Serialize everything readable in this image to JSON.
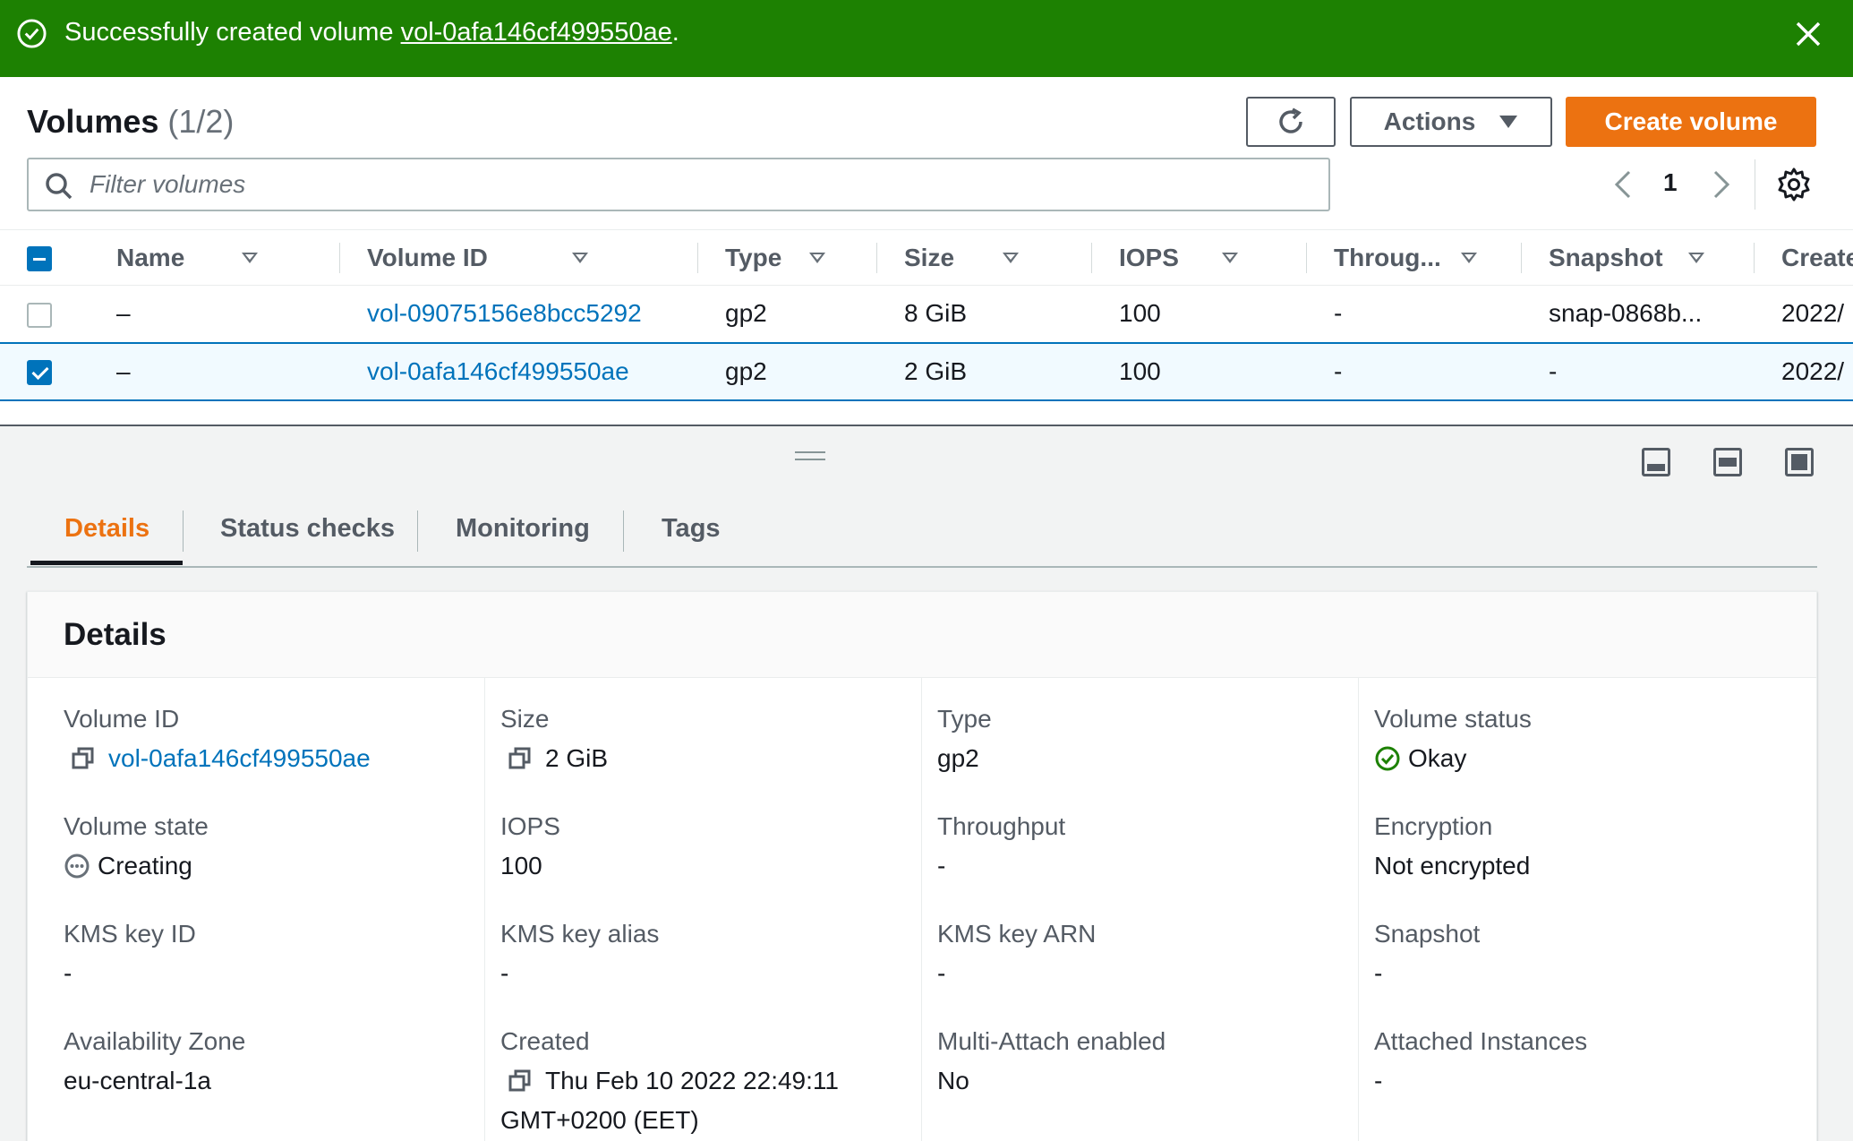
{
  "flash": {
    "message_prefix": "Successfully created volume ",
    "volume_link": "vol-0afa146cf499550ae",
    "message_suffix": ".",
    "color": "#1d8102"
  },
  "header": {
    "title": "Volumes",
    "count": "(1/2)",
    "actions_label": "Actions",
    "create_label": "Create volume",
    "accent_color": "#ec7211"
  },
  "filter": {
    "placeholder": "Filter volumes",
    "value": ""
  },
  "pager": {
    "page": "1"
  },
  "table": {
    "columns": [
      "Name",
      "Volume ID",
      "Type",
      "Size",
      "IOPS",
      "Throug...",
      "Snapshot",
      "Create"
    ],
    "rows": [
      {
        "selected": false,
        "name": "–",
        "volume_id": "vol-09075156e8bcc5292",
        "type": "gp2",
        "size": "8 GiB",
        "iops": "100",
        "throughput": "-",
        "snapshot": "snap-0868b...",
        "created": "2022/"
      },
      {
        "selected": true,
        "name": "–",
        "volume_id": "vol-0afa146cf499550ae",
        "type": "gp2",
        "size": "2 GiB",
        "iops": "100",
        "throughput": "-",
        "snapshot": "-",
        "created": "2022/"
      }
    ]
  },
  "tabs": [
    "Details",
    "Status checks",
    "Monitoring",
    "Tags"
  ],
  "details": {
    "title": "Details",
    "fields": {
      "volume_id": {
        "label": "Volume ID",
        "value": "vol-0afa146cf499550ae"
      },
      "size": {
        "label": "Size",
        "value": "2 GiB"
      },
      "type": {
        "label": "Type",
        "value": "gp2"
      },
      "volume_status": {
        "label": "Volume status",
        "value": "Okay"
      },
      "volume_state": {
        "label": "Volume state",
        "value": "Creating"
      },
      "iops": {
        "label": "IOPS",
        "value": "100"
      },
      "throughput": {
        "label": "Throughput",
        "value": "-"
      },
      "encryption": {
        "label": "Encryption",
        "value": "Not encrypted"
      },
      "kms_key_id": {
        "label": "KMS key ID",
        "value": "-"
      },
      "kms_key_alias": {
        "label": "KMS key alias",
        "value": "-"
      },
      "kms_key_arn": {
        "label": "KMS key ARN",
        "value": "-"
      },
      "snapshot": {
        "label": "Snapshot",
        "value": "-"
      },
      "availability_zone": {
        "label": "Availability Zone",
        "value": "eu-central-1a"
      },
      "created": {
        "label": "Created",
        "value_line1": "Thu Feb 10 2022 22:49:11",
        "value_line2": "GMT+0200 (EET)"
      },
      "multi_attach": {
        "label": "Multi-Attach enabled",
        "value": "No"
      },
      "attached_instances": {
        "label": "Attached Instances",
        "value": "-"
      }
    }
  }
}
